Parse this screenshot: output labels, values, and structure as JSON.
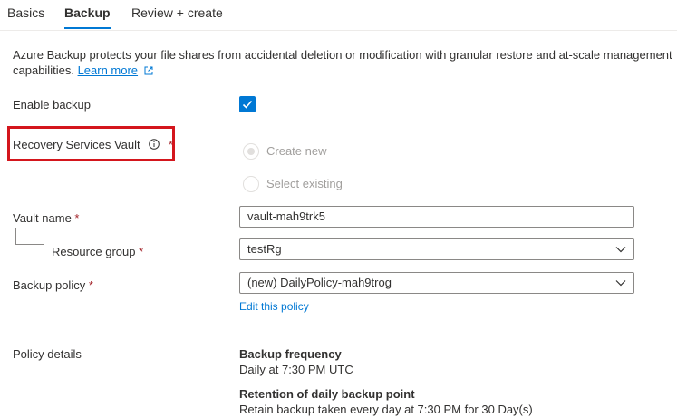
{
  "tabs": [
    {
      "label": "Basics"
    },
    {
      "label": "Backup"
    },
    {
      "label": "Review + create"
    }
  ],
  "description": {
    "text": "Azure Backup protects your file shares from accidental deletion or modification with granular restore and at-scale management capabilities.",
    "learn_more": "Learn more"
  },
  "enable_backup": {
    "label": "Enable backup",
    "checked": true
  },
  "recovery_vault": {
    "label": "Recovery Services Vault",
    "required_mark": "*",
    "options": [
      {
        "label": "Create new",
        "selected": true
      },
      {
        "label": "Select existing",
        "selected": false
      }
    ]
  },
  "vault_name": {
    "label": "Vault name",
    "required_mark": "*",
    "value": "vault-mah9trk5"
  },
  "resource_group": {
    "label": "Resource group",
    "required_mark": "*",
    "value": "testRg"
  },
  "backup_policy": {
    "label": "Backup policy",
    "required_mark": "*",
    "value": "(new) DailyPolicy-mah9trog",
    "edit_link": "Edit this policy"
  },
  "policy_details": {
    "label": "Policy details",
    "frequency_title": "Backup frequency",
    "frequency_value": "Daily at 7:30 PM UTC",
    "retention_title": "Retention of daily backup point",
    "retention_value": "Retain backup taken every day at 7:30 PM for 30 Day(s)"
  },
  "colors": {
    "accent": "#0078d4",
    "highlight": "#d4161d",
    "required": "#a4262c"
  }
}
